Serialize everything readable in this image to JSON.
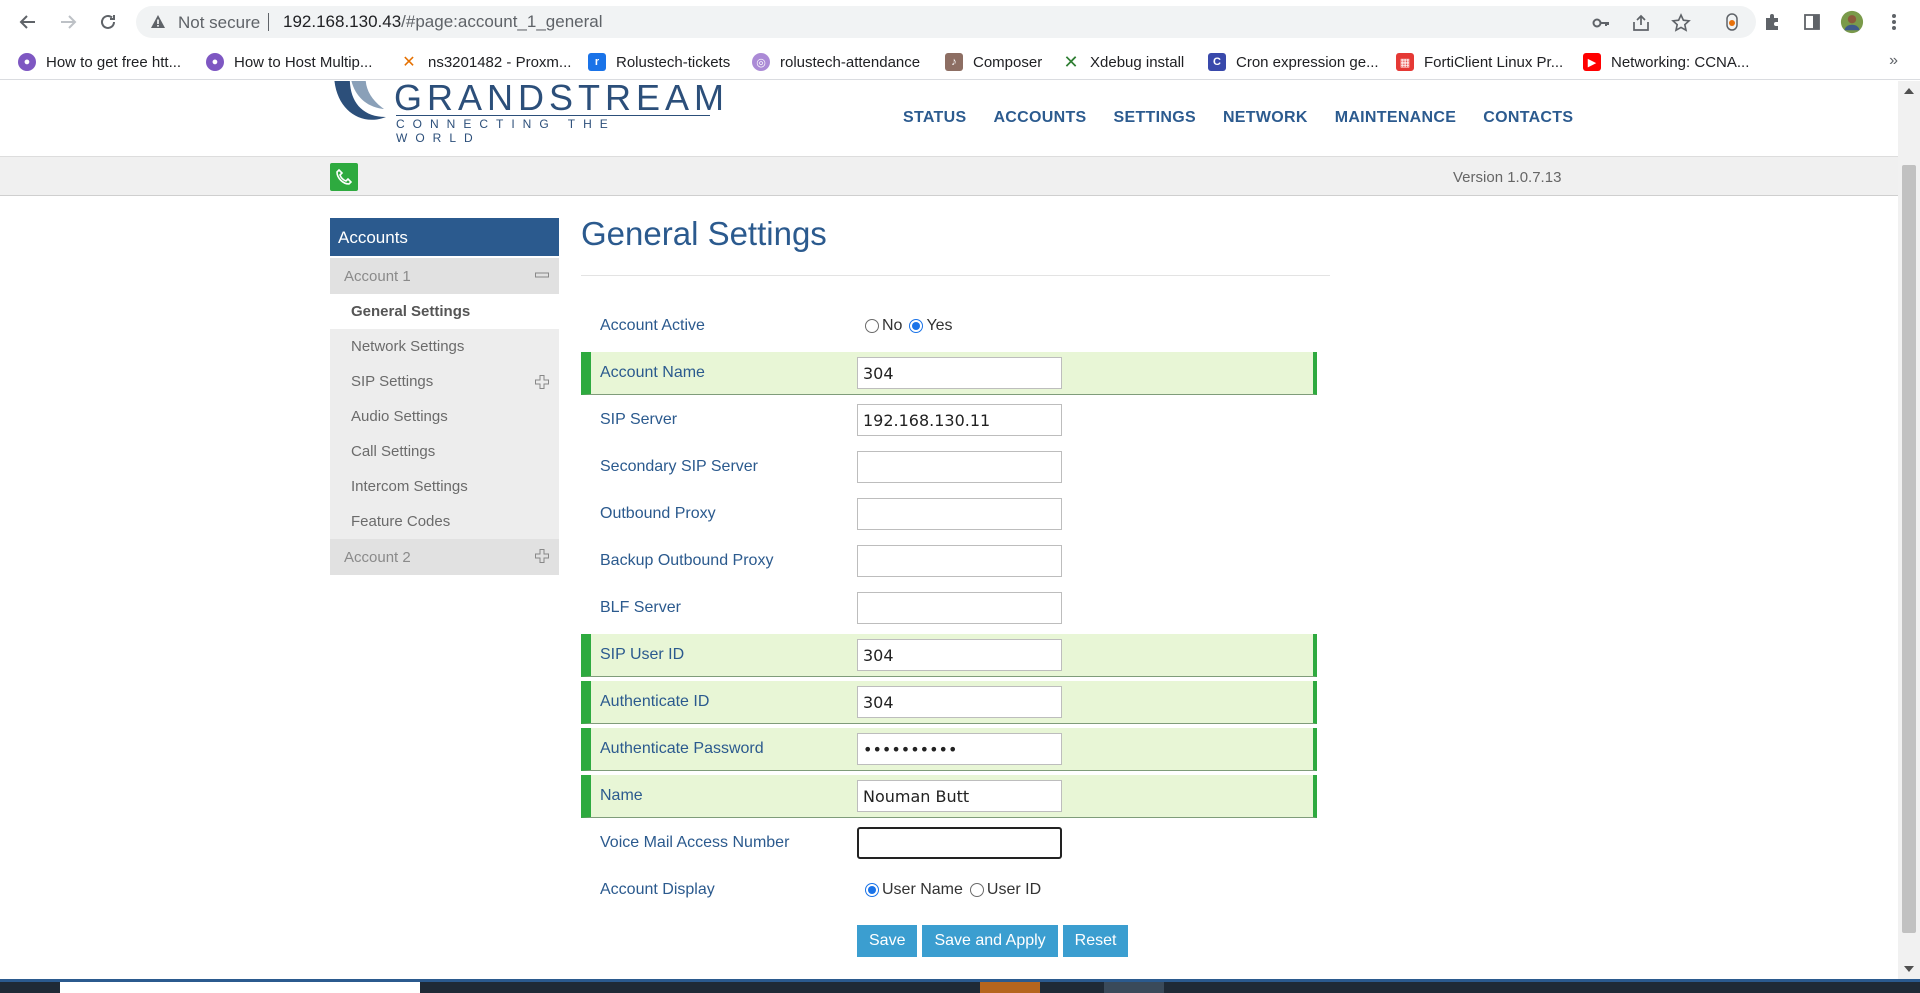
{
  "browser": {
    "security_label": "Not secure",
    "url_host": "192.168.130.43",
    "url_path": "/#page:account_1_general",
    "bookmarks": [
      {
        "label": "How to get free htt...",
        "icon": "avatar-icon"
      },
      {
        "label": "How to Host Multip...",
        "icon": "avatar-icon"
      },
      {
        "label": "ns3201482 - Proxm...",
        "icon": "proxmox-icon"
      },
      {
        "label": "Rolustech-tickets",
        "icon": "tickets-icon"
      },
      {
        "label": "rolustech-attendance",
        "icon": "attendance-icon"
      },
      {
        "label": "Composer",
        "icon": "composer-icon"
      },
      {
        "label": "Xdebug install",
        "icon": "xdebug-icon"
      },
      {
        "label": "Cron expression ge...",
        "icon": "cron-icon"
      },
      {
        "label": "FortiClient Linux Pr...",
        "icon": "fortinet-icon"
      },
      {
        "label": "Networking: CCNA...",
        "icon": "youtube-icon"
      }
    ],
    "more_label": "»"
  },
  "header": {
    "logo_text": "GRANDSTREAM",
    "logo_tagline": "CONNECTING THE WORLD",
    "nav": [
      "STATUS",
      "ACCOUNTS",
      "SETTINGS",
      "NETWORK",
      "MAINTENANCE",
      "CONTACTS"
    ],
    "version": "Version 1.0.7.13"
  },
  "sidebar": {
    "heading": "Accounts",
    "account1": "Account 1",
    "items": [
      "General Settings",
      "Network Settings",
      "SIP Settings",
      "Audio Settings",
      "Call Settings",
      "Intercom Settings",
      "Feature Codes"
    ],
    "account2": "Account 2"
  },
  "main": {
    "title": "General Settings",
    "account_active": {
      "label": "Account Active",
      "options": [
        "No",
        "Yes"
      ],
      "selected": "Yes"
    },
    "fields": [
      {
        "label": "Account Name",
        "value": "304"
      },
      {
        "label": "SIP Server",
        "value": "192.168.130.11"
      },
      {
        "label": "Secondary SIP Server",
        "value": ""
      },
      {
        "label": "Outbound Proxy",
        "value": ""
      },
      {
        "label": "Backup Outbound Proxy",
        "value": ""
      },
      {
        "label": "BLF Server",
        "value": ""
      },
      {
        "label": "SIP User ID",
        "value": "304"
      },
      {
        "label": "Authenticate ID",
        "value": "304"
      },
      {
        "label": "Authenticate Password",
        "value": "••••••••••"
      },
      {
        "label": "Name",
        "value": "Nouman Butt"
      },
      {
        "label": "Voice Mail Access Number",
        "value": ""
      }
    ],
    "account_display": {
      "label": "Account Display",
      "options": [
        "User Name",
        "User ID"
      ],
      "selected": "User Name"
    },
    "buttons": {
      "save": "Save",
      "save_apply": "Save and Apply",
      "reset": "Reset"
    }
  },
  "colors": {
    "brand_blue": "#2b5a8e",
    "required_green": "#2eaa3f",
    "required_bg": "#e8f6d6",
    "button_blue": "#3b9ed0"
  }
}
